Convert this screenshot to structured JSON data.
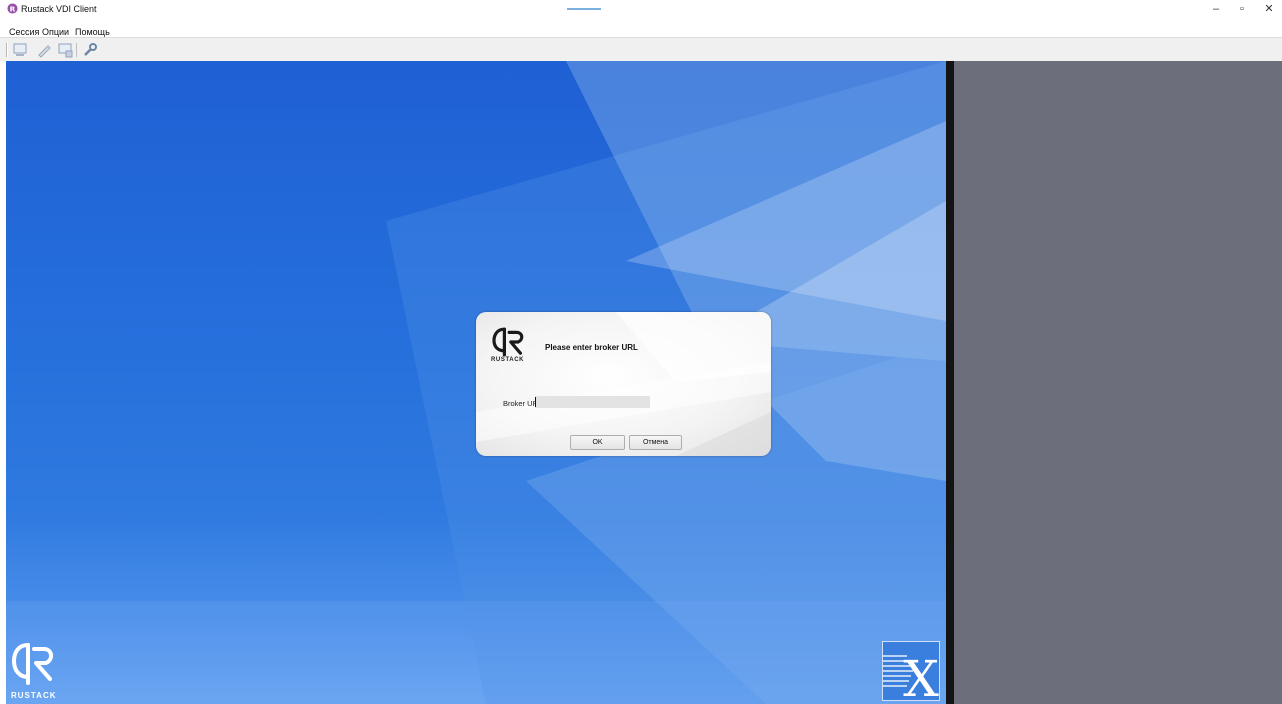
{
  "window": {
    "title": "Rustack VDI Client",
    "controls": {
      "minimize": "–",
      "maximize": "▫",
      "close": "✕"
    }
  },
  "menu": {
    "items": [
      "Сессия",
      "Опции",
      "Помощь"
    ]
  },
  "toolbar": {
    "icons": [
      "connect-icon",
      "edit-icon",
      "disconnect-icon",
      "settings-wrench-icon"
    ]
  },
  "desktop": {
    "logo_text": "RUSTACK",
    "corner_mark": "X"
  },
  "dialog": {
    "logo_text": "RUSTACK",
    "heading": "Please enter broker URL",
    "field_label": "Broker URL:",
    "field_value": "",
    "ok_label": "OK",
    "cancel_label": "Отмена"
  },
  "colors": {
    "desktop_blue": "#2670dc",
    "side_panel": "#6d6e7c",
    "toolbar_bg": "#f0f0f0"
  }
}
